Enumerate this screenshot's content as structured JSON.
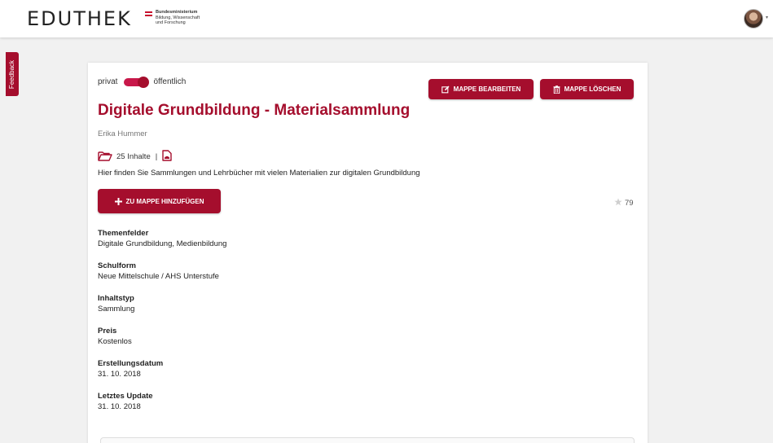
{
  "header": {
    "logo_text": "EDUTHEK",
    "ministry": {
      "line1": "Bundesministerium",
      "line2": "Bildung, Wissenschaft",
      "line3": "und Forschung"
    },
    "flag_colors": [
      "#c8102e",
      "#ffffff",
      "#c8102e"
    ]
  },
  "feedback_label": "Feedback",
  "visibility": {
    "left_label": "privat",
    "right_label": "öffentlich",
    "state": "öffentlich"
  },
  "actions": {
    "edit_label": "MAPPE BEARBEITEN",
    "delete_label": "MAPPE LÖSCHEN",
    "add_label": "ZU MAPPE HINZUFÜGEN"
  },
  "collection": {
    "title": "Digitale Grundbildung - Materialsammlung",
    "author": "Erika Hummer",
    "count_label": "25 Inhalte",
    "separator": "|",
    "description": "Hier finden Sie Sammlungen und Lehrbücher mit vielen Materialien zur digitalen Grundbildung",
    "rating": "79"
  },
  "properties": [
    {
      "label": "Themenfelder",
      "value": "Digitale Grundbildung, Medienbildung"
    },
    {
      "label": "Schulform",
      "value": "Neue Mittelschule / AHS Unterstufe"
    },
    {
      "label": "Inhaltstyp",
      "value": "Sammlung"
    },
    {
      "label": "Preis",
      "value": "Kostenlos"
    },
    {
      "label": "Erstellungsdatum",
      "value": "31. 10. 2018"
    },
    {
      "label": "Letztes Update",
      "value": "31. 10. 2018"
    }
  ],
  "colors": {
    "accent": "#a50e2d",
    "toggle": "#c8184a",
    "background": "#f1f1f1"
  },
  "icons": [
    "edit-icon",
    "trash-icon",
    "plus-icon",
    "folder-icon",
    "pdf-icon",
    "star-icon"
  ]
}
